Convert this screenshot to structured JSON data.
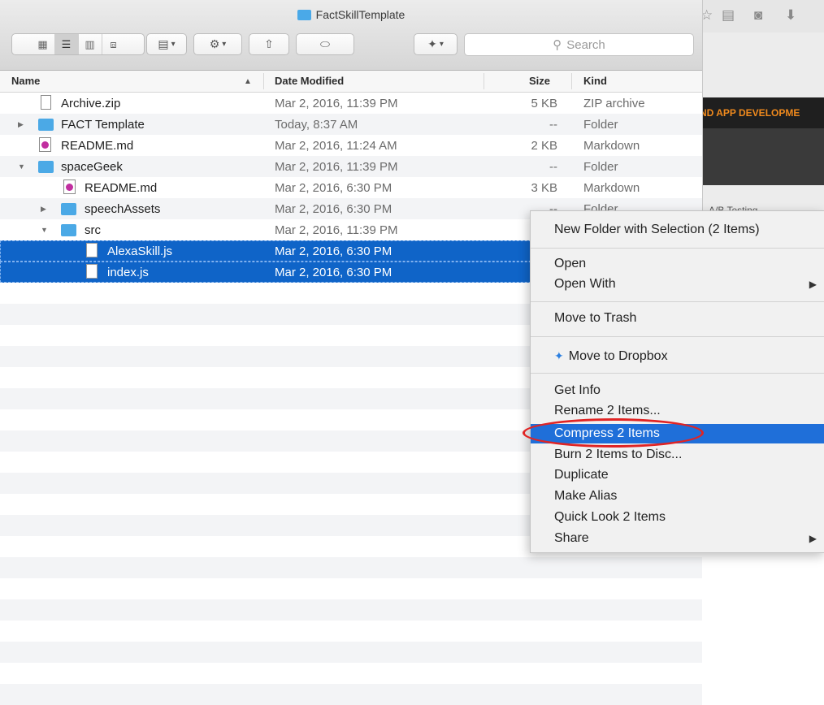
{
  "window": {
    "title": "FactSkillTemplate"
  },
  "toolbar": {
    "search_placeholder": "Search",
    "view_icons": [
      "icon-view",
      "list-view",
      "column-view",
      "coverflow-view"
    ]
  },
  "columns": {
    "name": "Name",
    "date": "Date Modified",
    "size": "Size",
    "kind": "Kind"
  },
  "files": [
    {
      "name": "Archive.zip",
      "date": "Mar 2, 2016, 11:39 PM",
      "size": "5 KB",
      "kind": "ZIP archive"
    },
    {
      "name": "FACT Template",
      "date": "Today, 8:37 AM",
      "size": "--",
      "kind": "Folder"
    },
    {
      "name": "README.md",
      "date": "Mar 2, 2016, 11:24 AM",
      "size": "2 KB",
      "kind": "Markdown"
    },
    {
      "name": "spaceGeek",
      "date": "Mar 2, 2016, 11:39 PM",
      "size": "--",
      "kind": "Folder"
    },
    {
      "name": "README.md",
      "date": "Mar 2, 2016, 6:30 PM",
      "size": "3 KB",
      "kind": "Markdown"
    },
    {
      "name": "speechAssets",
      "date": "Mar 2, 2016, 6:30 PM",
      "size": "--",
      "kind": "Folder"
    },
    {
      "name": "src",
      "date": "Mar 2, 2016, 11:39 PM",
      "size": "",
      "kind": ""
    },
    {
      "name": "AlexaSkill.js",
      "date": "Mar 2, 2016, 6:30 PM",
      "size": "",
      "kind": ""
    },
    {
      "name": "index.js",
      "date": "Mar 2, 2016, 6:30 PM",
      "size": "",
      "kind": ""
    }
  ],
  "context_menu": {
    "new_folder": "New Folder with Selection (2 Items)",
    "open": "Open",
    "open_with": "Open With",
    "move_to_trash": "Move to Trash",
    "move_to_dropbox": "Move to Dropbox",
    "get_info": "Get Info",
    "rename": "Rename 2 Items...",
    "compress": "Compress 2 Items",
    "burn": "Burn 2 Items to Disc...",
    "duplicate": "Duplicate",
    "make_alias": "Make Alias",
    "quick_look": "Quick Look 2 Items",
    "share": "Share"
  },
  "background": {
    "banner_text": "ND APP DEVELOPME",
    "ab_text": "A/B Testing"
  },
  "colors": {
    "selection": "#0f64c8",
    "menu_highlight": "#1f6fd9",
    "annotation": "#e02424",
    "banner": "#f08a1d"
  }
}
